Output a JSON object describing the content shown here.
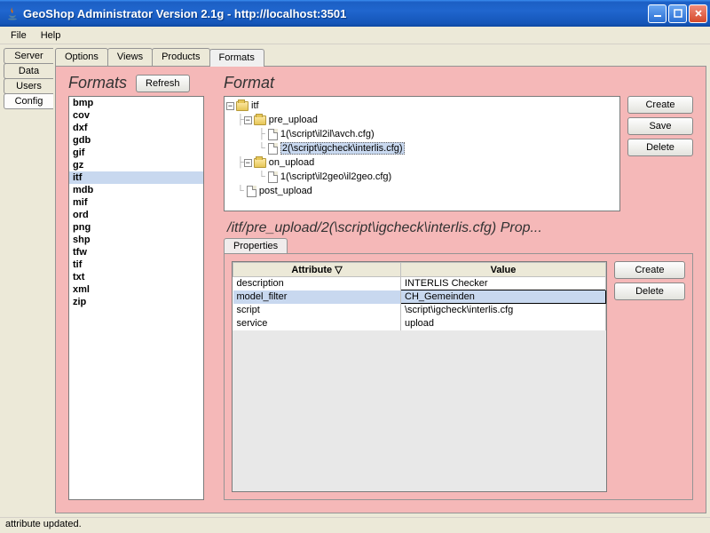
{
  "window": {
    "title": "GeoShop Administrator Version 2.1g - http://localhost:3501"
  },
  "menubar": {
    "file": "File",
    "help": "Help"
  },
  "left_tabs": [
    "Server",
    "Data",
    "Users",
    "Config"
  ],
  "left_tab_active": 3,
  "main_tabs": [
    "Options",
    "Views",
    "Products",
    "Formats"
  ],
  "main_tab_active": 3,
  "formats_panel": {
    "title": "Formats",
    "refresh": "Refresh",
    "items": [
      "bmp",
      "cov",
      "dxf",
      "gdb",
      "gif",
      "gz",
      "itf",
      "mdb",
      "mif",
      "ord",
      "png",
      "shp",
      "tfw",
      "tif",
      "txt",
      "xml",
      "zip"
    ],
    "selected": "itf"
  },
  "format_panel": {
    "title": "Format",
    "create": "Create",
    "save": "Save",
    "delete": "Delete",
    "tree": {
      "root": "itf",
      "pre_upload": "pre_upload",
      "pre1": "1(\\script\\il2il\\avch.cfg)",
      "pre2": "2(\\script\\igcheck\\interlis.cfg)",
      "on_upload": "on_upload",
      "on1": "1(\\script\\il2geo\\il2geo.cfg)",
      "post_upload": "post_upload"
    }
  },
  "props": {
    "title": "/itf/pre_upload/2(\\script\\igcheck\\interlis.cfg) Prop...",
    "tab": "Properties",
    "headers": {
      "attr": "Attribute",
      "val": "Value"
    },
    "rows": [
      {
        "attr": "description",
        "val": "INTERLIS Checker"
      },
      {
        "attr": "model_filter",
        "val": "CH_Gemeinden"
      },
      {
        "attr": "script",
        "val": "\\script\\igcheck\\interlis.cfg"
      },
      {
        "attr": "service",
        "val": "upload"
      }
    ],
    "selected_row": 1,
    "create": "Create",
    "delete": "Delete"
  },
  "status": "attribute updated."
}
